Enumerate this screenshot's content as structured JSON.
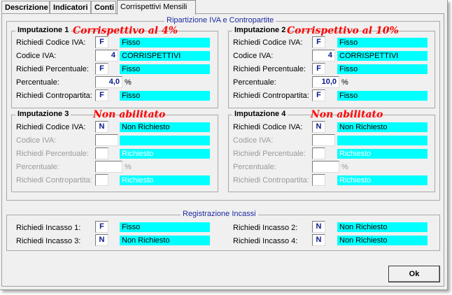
{
  "tabs": [
    {
      "label": "Descrizione"
    },
    {
      "label": "Indicatori"
    },
    {
      "label": "Conti"
    },
    {
      "label": "Corrispettivi Mensili"
    }
  ],
  "ripartizione": {
    "title": "Ripartizione IVA e Contropartite",
    "labels": {
      "richiedi_codice_iva": "Richiedi Codice IVA:",
      "codice_iva": "Codice IVA:",
      "richiedi_percentuale": "Richiedi Percentuale:",
      "percentuale": "Percentuale:",
      "richiedi_contropartita": "Richiedi Contropartita:"
    },
    "imp1": {
      "title": "Imputazione 1",
      "note": "Corrispettivo al 4%",
      "flag_codice": "F",
      "val_codice": "Fisso",
      "codice": "4",
      "codice_desc": "CORRISPETTIVI",
      "flag_perc": "F",
      "val_perc": "Fisso",
      "perc": "4,0",
      "pct_sign": "%",
      "flag_contro": "F",
      "val_contro": "Fisso"
    },
    "imp2": {
      "title": "Imputazione 2",
      "note": "Corrispettivo al 10%",
      "flag_codice": "F",
      "val_codice": "Fisso",
      "codice": "4",
      "codice_desc": "CORRISPETTIVI",
      "flag_perc": "F",
      "val_perc": "Fisso",
      "perc": "10,0",
      "pct_sign": "%",
      "flag_contro": "F",
      "val_contro": "Fisso"
    },
    "imp3": {
      "title": "Imputazione 3",
      "note": "Non abilitato",
      "flag_codice": "N",
      "val_codice": "Non Richiesto",
      "val_perc": "Richiesto",
      "pct_sign": "%",
      "val_contro": "Richiesto"
    },
    "imp4": {
      "title": "Imputazione 4",
      "note": "Non abilitato",
      "flag_codice": "N",
      "val_codice": "Non Richiesto",
      "val_perc": "Richiesto",
      "pct_sign": "%",
      "val_contro": "Richiesto"
    }
  },
  "registrazione": {
    "title": "Registrazione Incassi",
    "inc1": {
      "label": "Richiedi Incasso 1:",
      "flag": "F",
      "value": "Fisso"
    },
    "inc2": {
      "label": "Richiedi Incasso 2:",
      "flag": "N",
      "value": "Non Richiesto"
    },
    "inc3": {
      "label": "Richiedi Incasso 3:",
      "flag": "N",
      "value": "Non Richiesto"
    },
    "inc4": {
      "label": "Richiedi Incasso 4:",
      "flag": "N",
      "value": "Non Richiesto"
    }
  },
  "ok_label": "Ok"
}
